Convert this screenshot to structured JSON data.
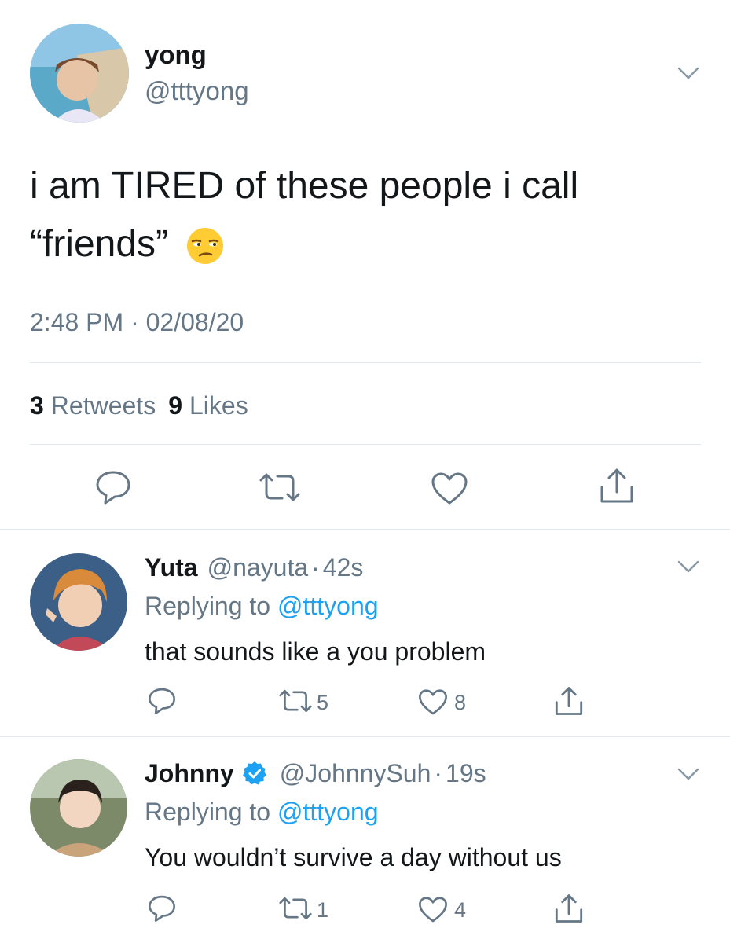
{
  "tweet": {
    "author_name": "yong",
    "author_handle": "@tttyong",
    "text_line1": "i am TIRED of these people i call",
    "text_line2": "“friends”",
    "emoji": "unamused-face-emoji",
    "timestamp": "2:48 PM · 02/08/20",
    "retweets_count": "3",
    "retweets_label": "Retweets",
    "likes_count": "9",
    "likes_label": "Likes"
  },
  "replies": [
    {
      "author_name": "Yuta",
      "author_handle": "@nayuta",
      "separator": "·",
      "time": "42s",
      "replying_prefix": "Replying to",
      "replying_to": "@tttyong",
      "text": "that sounds like a you problem",
      "retweets": "5",
      "likes": "8",
      "verified": false
    },
    {
      "author_name": "Johnny",
      "author_handle": "@JohnnySuh",
      "separator": "·",
      "time": "19s",
      "replying_prefix": "Replying to",
      "replying_to": "@tttyong",
      "text": "You wouldn’t survive a day without us",
      "retweets": "1",
      "likes": "4",
      "verified": true
    }
  ],
  "colors": {
    "accent": "#1da1f2",
    "secondary_text": "#657786",
    "divider": "#e1e8ed",
    "icon": "#657786"
  }
}
